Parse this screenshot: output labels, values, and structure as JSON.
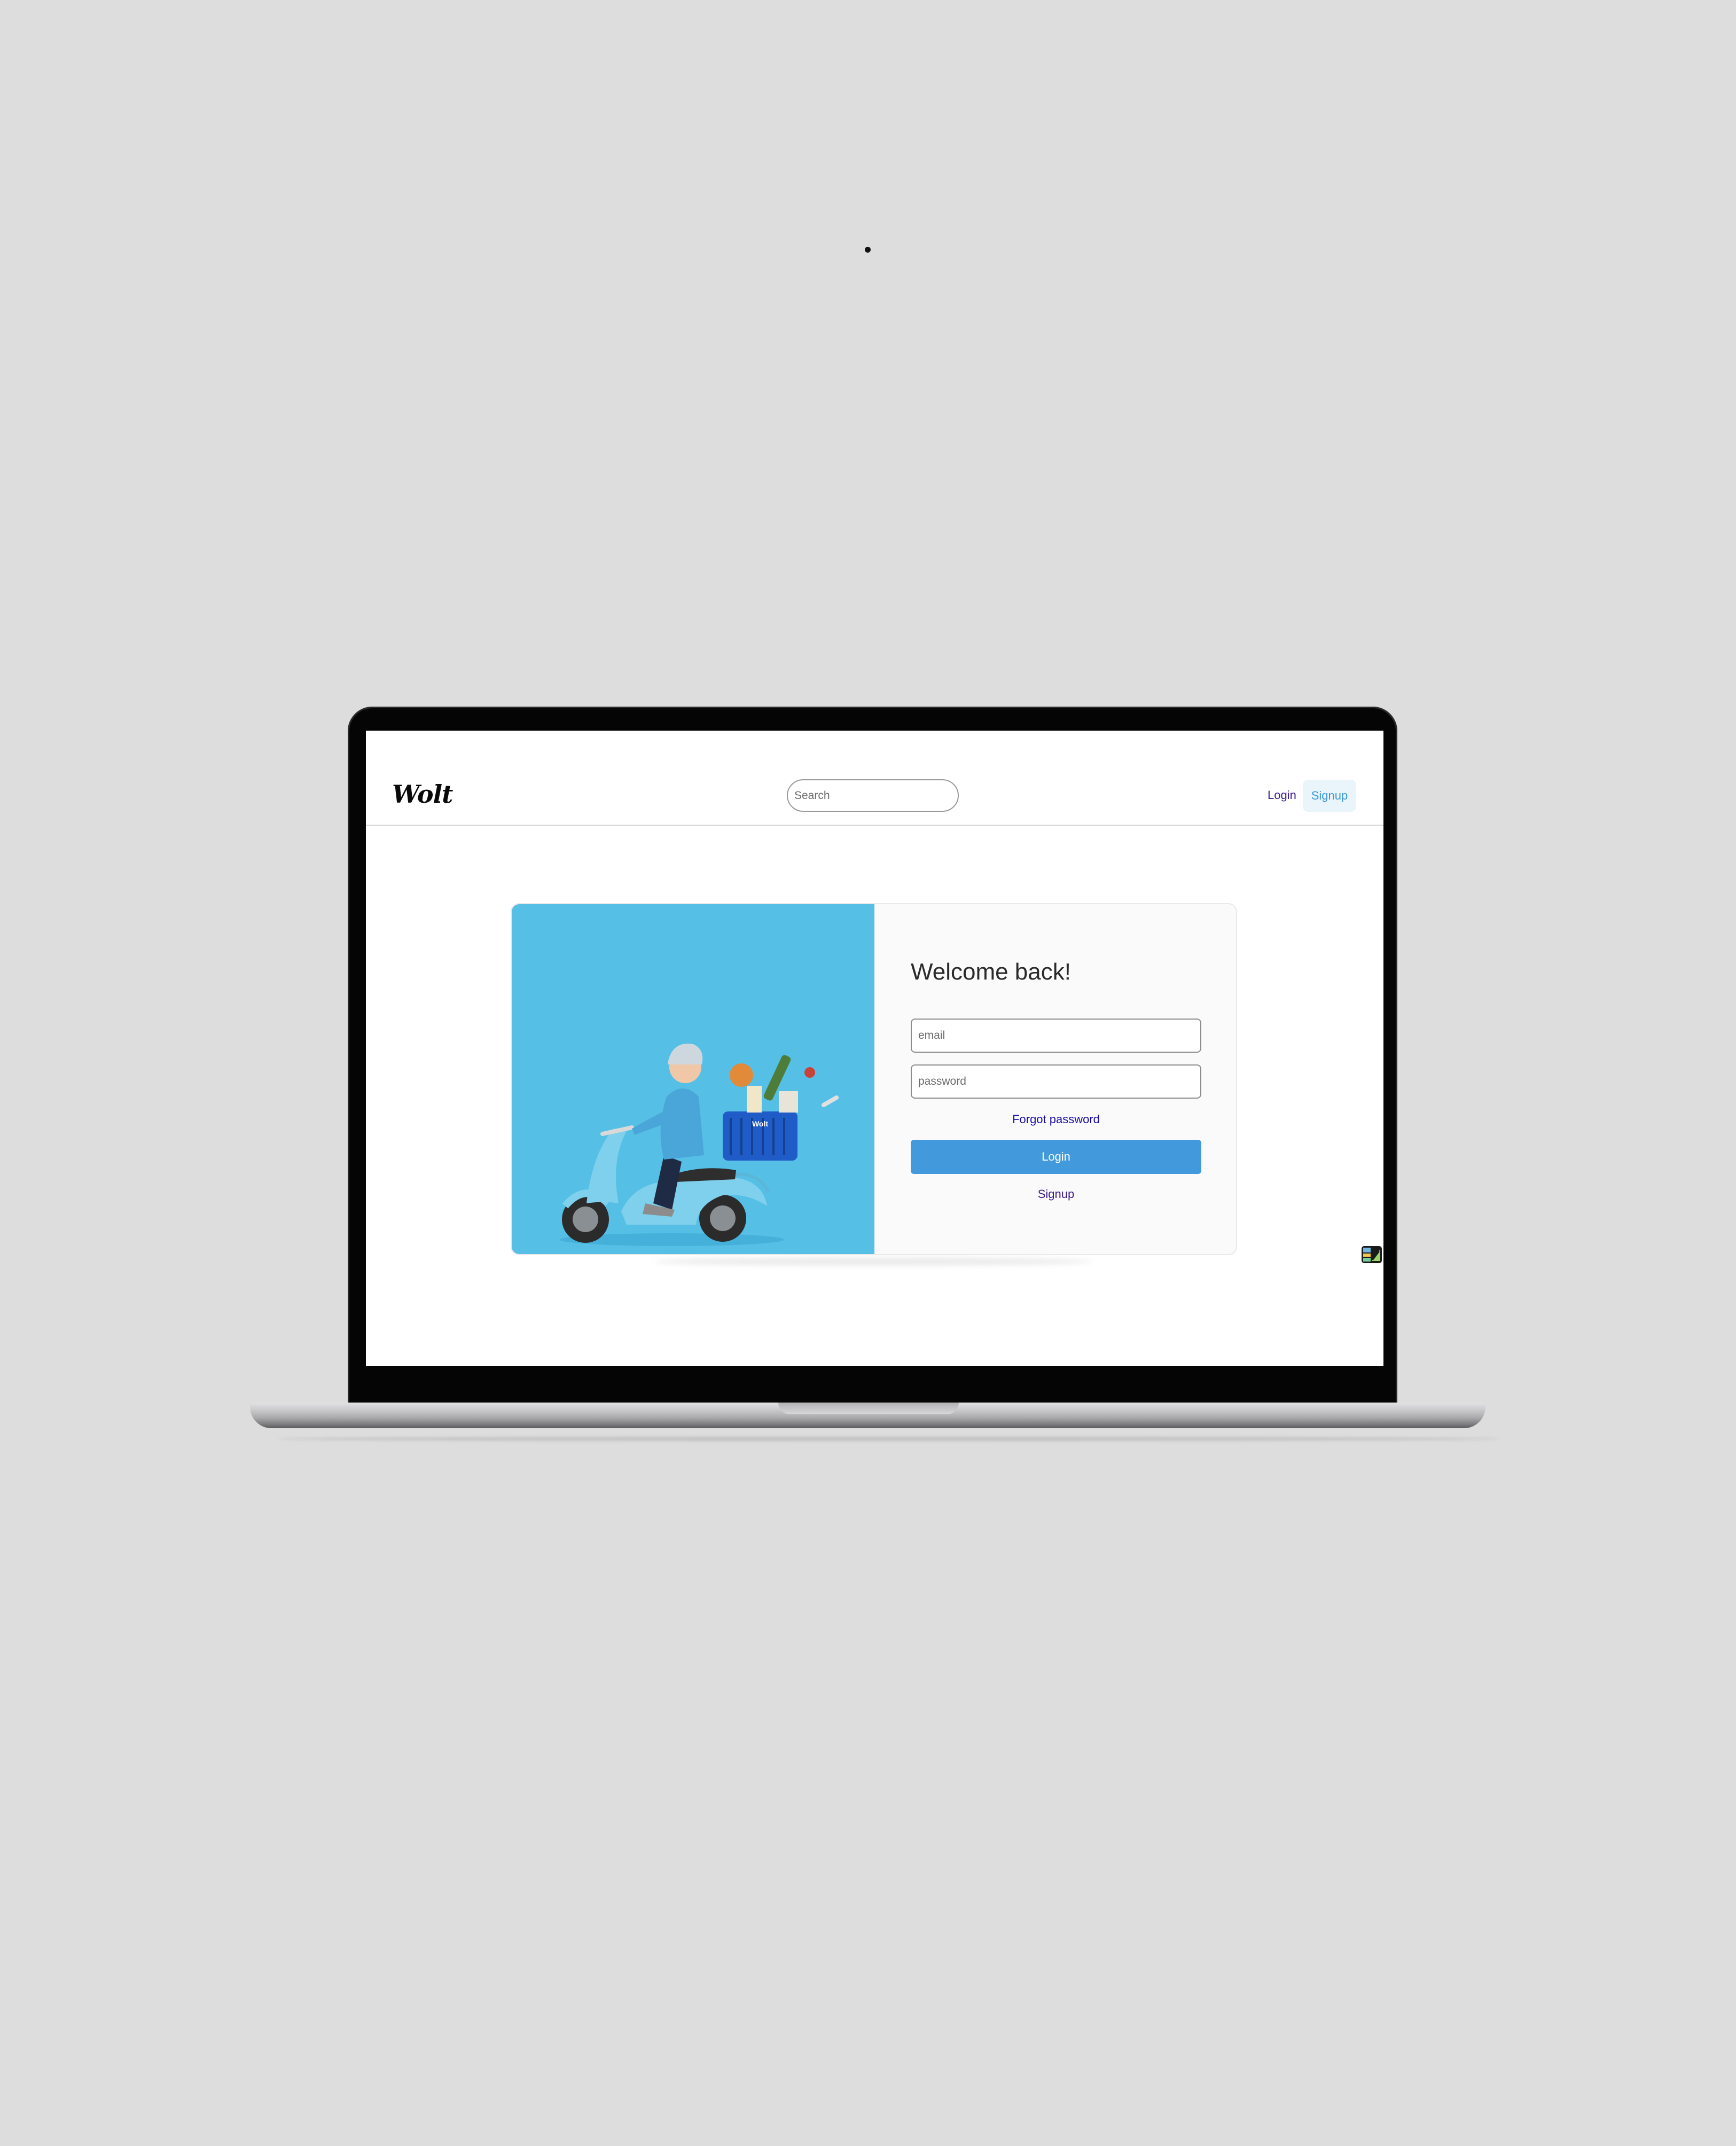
{
  "header": {
    "logo_text": "Wolt",
    "search_placeholder": "Search",
    "login_label": "Login",
    "signup_label": "Signup"
  },
  "login_card": {
    "title": "Welcome back!",
    "email_placeholder": "email",
    "password_placeholder": "password",
    "forgot_password_label": "Forgot password",
    "login_button_label": "Login",
    "signup_link_label": "Signup",
    "hero_image": {
      "description_icon": "scooter-courier-illustration",
      "basket_label": "Wolt"
    }
  },
  "colors": {
    "background": "#dddddd",
    "hero_blue": "#56bfe6",
    "button_blue": "#4299dc",
    "link_purple": "#3d1a8c",
    "forgot_link_blue": "#1a0ea8",
    "signup_pill_bg": "#eaf4fb",
    "signup_pill_text": "#3b9ad9"
  },
  "icons": {
    "floating_extension": "image-edit-icon"
  }
}
